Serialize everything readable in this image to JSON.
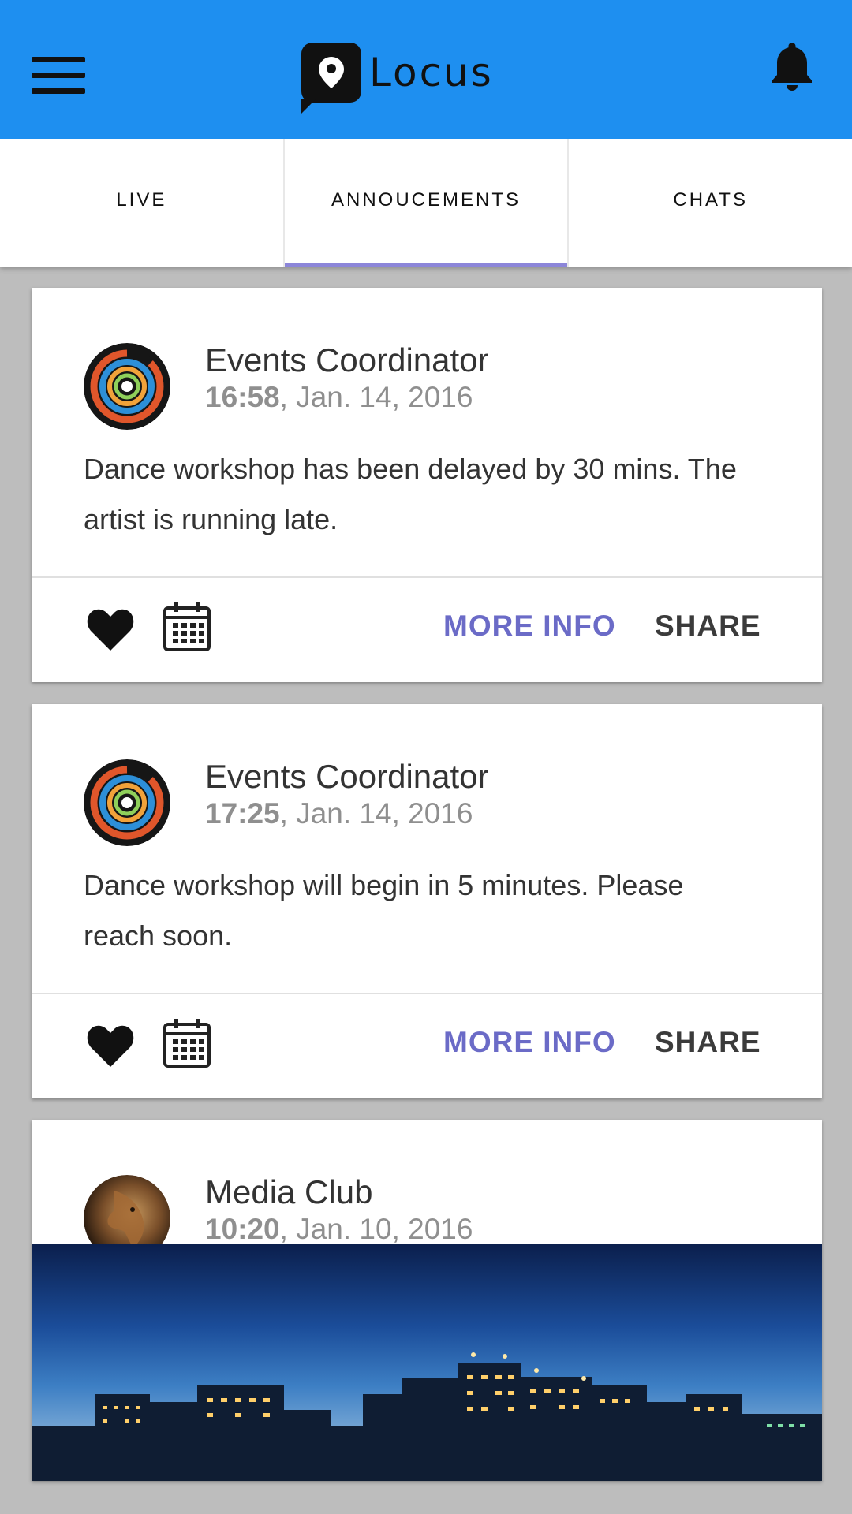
{
  "app": {
    "title": "Locus"
  },
  "icons": {
    "menu": "menu-icon",
    "logo": "location-pin-icon",
    "notifications": "bell-icon",
    "like": "heart-icon",
    "calendar": "calendar-icon"
  },
  "colors": {
    "app_bar": "#1e8ff0",
    "tab_indicator": "#8c86d9",
    "more_info": "#6b6bc7",
    "background": "#bdbdbd"
  },
  "tabs": [
    {
      "label": "LIVE",
      "active": false
    },
    {
      "label": "ANNOUCEMENTS",
      "active": true
    },
    {
      "label": "CHATS",
      "active": false
    }
  ],
  "posts": [
    {
      "author": "Events Coordinator",
      "time": "16:58",
      "date": ", Jan. 14, 2016",
      "body": "Dance workshop has been delayed by 30 mins. The artist is running late.",
      "more_info_label": "MORE INFO",
      "share_label": "SHARE"
    },
    {
      "author": "Events Coordinator",
      "time": "17:25",
      "date": ", Jan. 14, 2016",
      "body": "Dance workshop will begin in 5 minutes. Please reach soon.",
      "more_info_label": "MORE INFO",
      "share_label": "SHARE"
    },
    {
      "author": "Media Club",
      "time": "10:20",
      "date": ", Jan. 10, 2016"
    }
  ]
}
